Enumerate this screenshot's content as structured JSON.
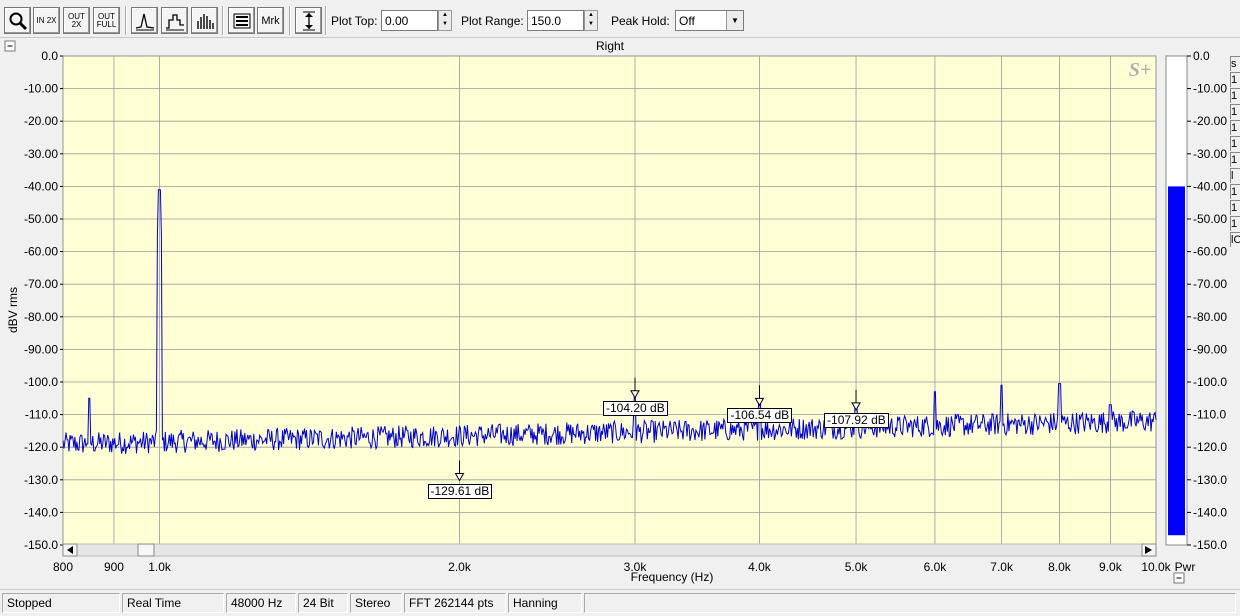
{
  "toolbar": {
    "buttons": [
      {
        "name": "zoom-button",
        "icon": "magnifier-icon",
        "label": ""
      },
      {
        "name": "zoom-in-2x-button",
        "icon": "zoom-in-icon",
        "label": "IN 2X"
      },
      {
        "name": "zoom-out-2x-button",
        "icon": "zoom-out-icon",
        "label": "OUT 2X"
      },
      {
        "name": "zoom-out-full-button",
        "icon": "zoom-full-icon",
        "label": "OUT FULL"
      },
      {
        "name": "line-mode-button",
        "icon": "line-graph-icon",
        "label": ""
      },
      {
        "name": "step-mode-button",
        "icon": "step-graph-icon",
        "label": ""
      },
      {
        "name": "bar-mode-button",
        "icon": "bar-graph-icon",
        "label": ""
      },
      {
        "name": "settings-panel-button",
        "icon": "panel-icon",
        "label": ""
      },
      {
        "name": "marker-button",
        "icon": "marker-icon",
        "label": "Mrk"
      },
      {
        "name": "autoscale-button",
        "icon": "vertical-range-icon",
        "label": ""
      }
    ],
    "plot_top_label": "Plot Top:",
    "plot_top_value": "0.00",
    "plot_range_label": "Plot Range:",
    "plot_range_value": "150.0",
    "peak_hold_label": "Peak Hold:",
    "peak_hold_value": "Off"
  },
  "plot": {
    "channel_title": "Right",
    "logo": "S+",
    "collapse_glyph": "−"
  },
  "chart_data": {
    "type": "line",
    "xlabel": "Frequency (Hz)",
    "ylabel": "dBV rms",
    "xscale": "log",
    "xlim": [
      800,
      10000
    ],
    "ylim": [
      -150,
      0
    ],
    "grid": true,
    "background": "#ffffd6",
    "line_color": "#0000cc",
    "x_ticks": [
      800,
      900,
      1000,
      2000,
      3000,
      4000,
      5000,
      6000,
      7000,
      8000,
      9000,
      10000
    ],
    "x_tick_labels": [
      "800",
      "900",
      "1.0k",
      "2.0k",
      "3.0k",
      "4.0k",
      "5.0k",
      "6.0k",
      "7.0k",
      "8.0k",
      "9.0k",
      "10.0k"
    ],
    "y_ticks": [
      0,
      -10,
      -20,
      -30,
      -40,
      -50,
      -60,
      -70,
      -80,
      -90,
      -100,
      -110,
      -120,
      -130,
      -140,
      -150
    ],
    "y_tick_labels": [
      "0.0",
      "-10.00",
      "-20.00",
      "-30.00",
      "-40.00",
      "-50.00",
      "-60.00",
      "-70.00",
      "-80.00",
      "-90.00",
      "-100.0",
      "-110.0",
      "-120.0",
      "-130.0",
      "-140.0",
      "-150.0"
    ],
    "noise_floor": {
      "start": -119,
      "end": -112
    },
    "peaks": [
      {
        "x": 850,
        "y": -105
      },
      {
        "x": 1000,
        "y": -41
      },
      {
        "x": 3000,
        "y": -104.2
      },
      {
        "x": 4000,
        "y": -106.5
      },
      {
        "x": 5000,
        "y": -107.9
      },
      {
        "x": 6000,
        "y": -103
      },
      {
        "x": 7000,
        "y": -101
      },
      {
        "x": 8000,
        "y": -100.5
      },
      {
        "x": 9000,
        "y": -107
      }
    ],
    "markers": [
      {
        "x": 2000,
        "y": -129.61,
        "label": "-129.61 dB"
      },
      {
        "x": 3000,
        "y": -104.2,
        "label": "-104.20 dB"
      },
      {
        "x": 4000,
        "y": -106.54,
        "label": "-106.54 dB"
      },
      {
        "x": 5000,
        "y": -107.92,
        "label": "-107.92 dB"
      }
    ]
  },
  "meter": {
    "level_db": -40,
    "color": "#0000ff",
    "label": "Pwr",
    "tick_labels": [
      "0.0",
      "-10.00",
      "-20.00",
      "-30.00",
      "-40.00",
      "-50.00",
      "-60.00",
      "-70.00",
      "-80.00",
      "-90.00",
      "-100.0",
      "-110.0",
      "-120.0",
      "-130.0",
      "-140.0",
      "-150.0"
    ]
  },
  "side_tabs": [
    "s",
    "1",
    "1",
    "1",
    "1",
    "1",
    "1",
    "l",
    "1",
    "1",
    "1",
    "lO"
  ],
  "status": [
    "Stopped",
    "Real Time",
    "48000 Hz",
    "24 Bit",
    "Stereo",
    "FFT 262144 pts",
    "Hanning"
  ]
}
